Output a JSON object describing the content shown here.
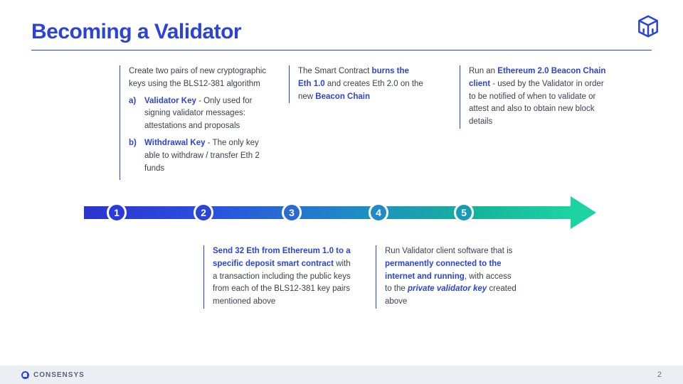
{
  "header": {
    "title": "Becoming a Validator"
  },
  "steps": {
    "s1": {
      "intro": "Create two pairs of new cryptographic keys using the BLS12-381 algorithm",
      "a_label": "Validator Key",
      "a_desc": " - Only used for signing validator messages: attestations and proposals",
      "b_label": "Withdrawal Key",
      "b_desc": " - The only key able to withdraw / transfer Eth 2 funds",
      "letter_a": "a)",
      "letter_b": "b)"
    },
    "s2": {
      "bold": "Send 32 Eth from Ethereum 1.0 to a specific deposit smart contract",
      "rest": " with a transaction including the public keys from each of the BLS12-381 key pairs mentioned above"
    },
    "s3": {
      "lead": "The Smart Contract ",
      "bold1": "burns the Eth 1.0",
      "mid": " and creates Eth 2.0 on the new ",
      "bold2": "Beacon Chain"
    },
    "s4": {
      "lead": "Run Validator client software that is ",
      "bold1": "permanently connected to the internet and running",
      "mid": ", with access to the ",
      "bold2": "private validator key",
      "rest": " created above"
    },
    "s5": {
      "lead": "Run an ",
      "bold": "Ethereum 2.0 Beacon Chain client",
      "rest": " - used by the Validator in order to be notified of when to validate or attest and also to obtain new block details"
    }
  },
  "nodes": {
    "n1": "1",
    "n2": "2",
    "n3": "3",
    "n4": "4",
    "n5": "5"
  },
  "footer": {
    "brand": "CONSENSYS",
    "page": "2"
  }
}
